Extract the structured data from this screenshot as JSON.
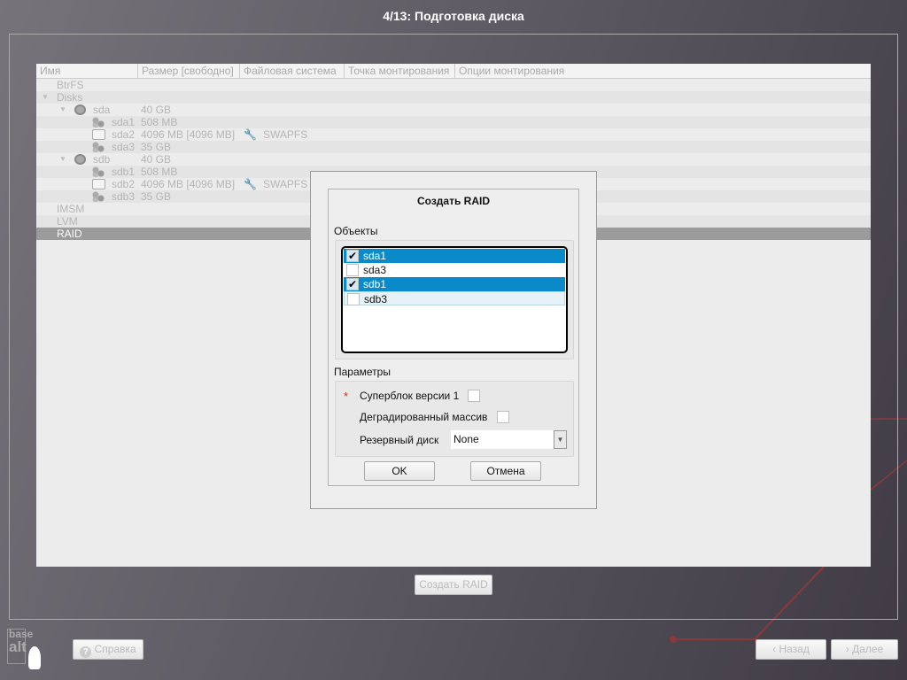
{
  "title": "4/13: Подготовка диска",
  "table": {
    "columns": [
      "Имя",
      "Размер [свободно]",
      "Файловая система",
      "Точка монтирования",
      "Опции монтирования"
    ],
    "rows": [
      {
        "name": "BtrFS",
        "size": "",
        "fs": ""
      },
      {
        "name": "Disks",
        "size": "",
        "fs": ""
      },
      {
        "name": "sda",
        "size": "40 GB",
        "fs": ""
      },
      {
        "name": "sda1",
        "size": "508 MB",
        "fs": ""
      },
      {
        "name": "sda2",
        "size": "4096 MB [4096 MB]",
        "fs": "SWAPFS"
      },
      {
        "name": "sda3",
        "size": "35 GB",
        "fs": ""
      },
      {
        "name": "sdb",
        "size": "40 GB",
        "fs": ""
      },
      {
        "name": "sdb1",
        "size": "508 MB",
        "fs": ""
      },
      {
        "name": "sdb2",
        "size": "4096 MB [4096 MB]",
        "fs": "SWAPFS"
      },
      {
        "name": "sdb3",
        "size": "35 GB",
        "fs": ""
      },
      {
        "name": "IMSM",
        "size": "",
        "fs": ""
      },
      {
        "name": "LVM",
        "size": "",
        "fs": ""
      },
      {
        "name": "RAID",
        "size": "",
        "fs": ""
      }
    ]
  },
  "dialog": {
    "title": "Создать RAID",
    "objects_label": "Объекты",
    "objects": [
      {
        "label": "sda1",
        "checked": true
      },
      {
        "label": "sda3",
        "checked": false
      },
      {
        "label": "sdb1",
        "checked": true
      },
      {
        "label": "sdb3",
        "checked": false
      }
    ],
    "params_label": "Параметры",
    "required_mark": "*",
    "superblock_label": "Суперблок версии 1",
    "degraded_label": "Деградированный массив",
    "spare_label": "Резервный диск",
    "spare_value": "None",
    "ok": "OK",
    "cancel": "Отмена"
  },
  "create_raid_button": "Создать RAID",
  "help_button": "Справка",
  "back_button": "Назад",
  "next_button": "Далее",
  "logo": "base alt",
  "colors": {
    "selection": "#0a8ac8",
    "accent_line": "#8a3a3a"
  }
}
